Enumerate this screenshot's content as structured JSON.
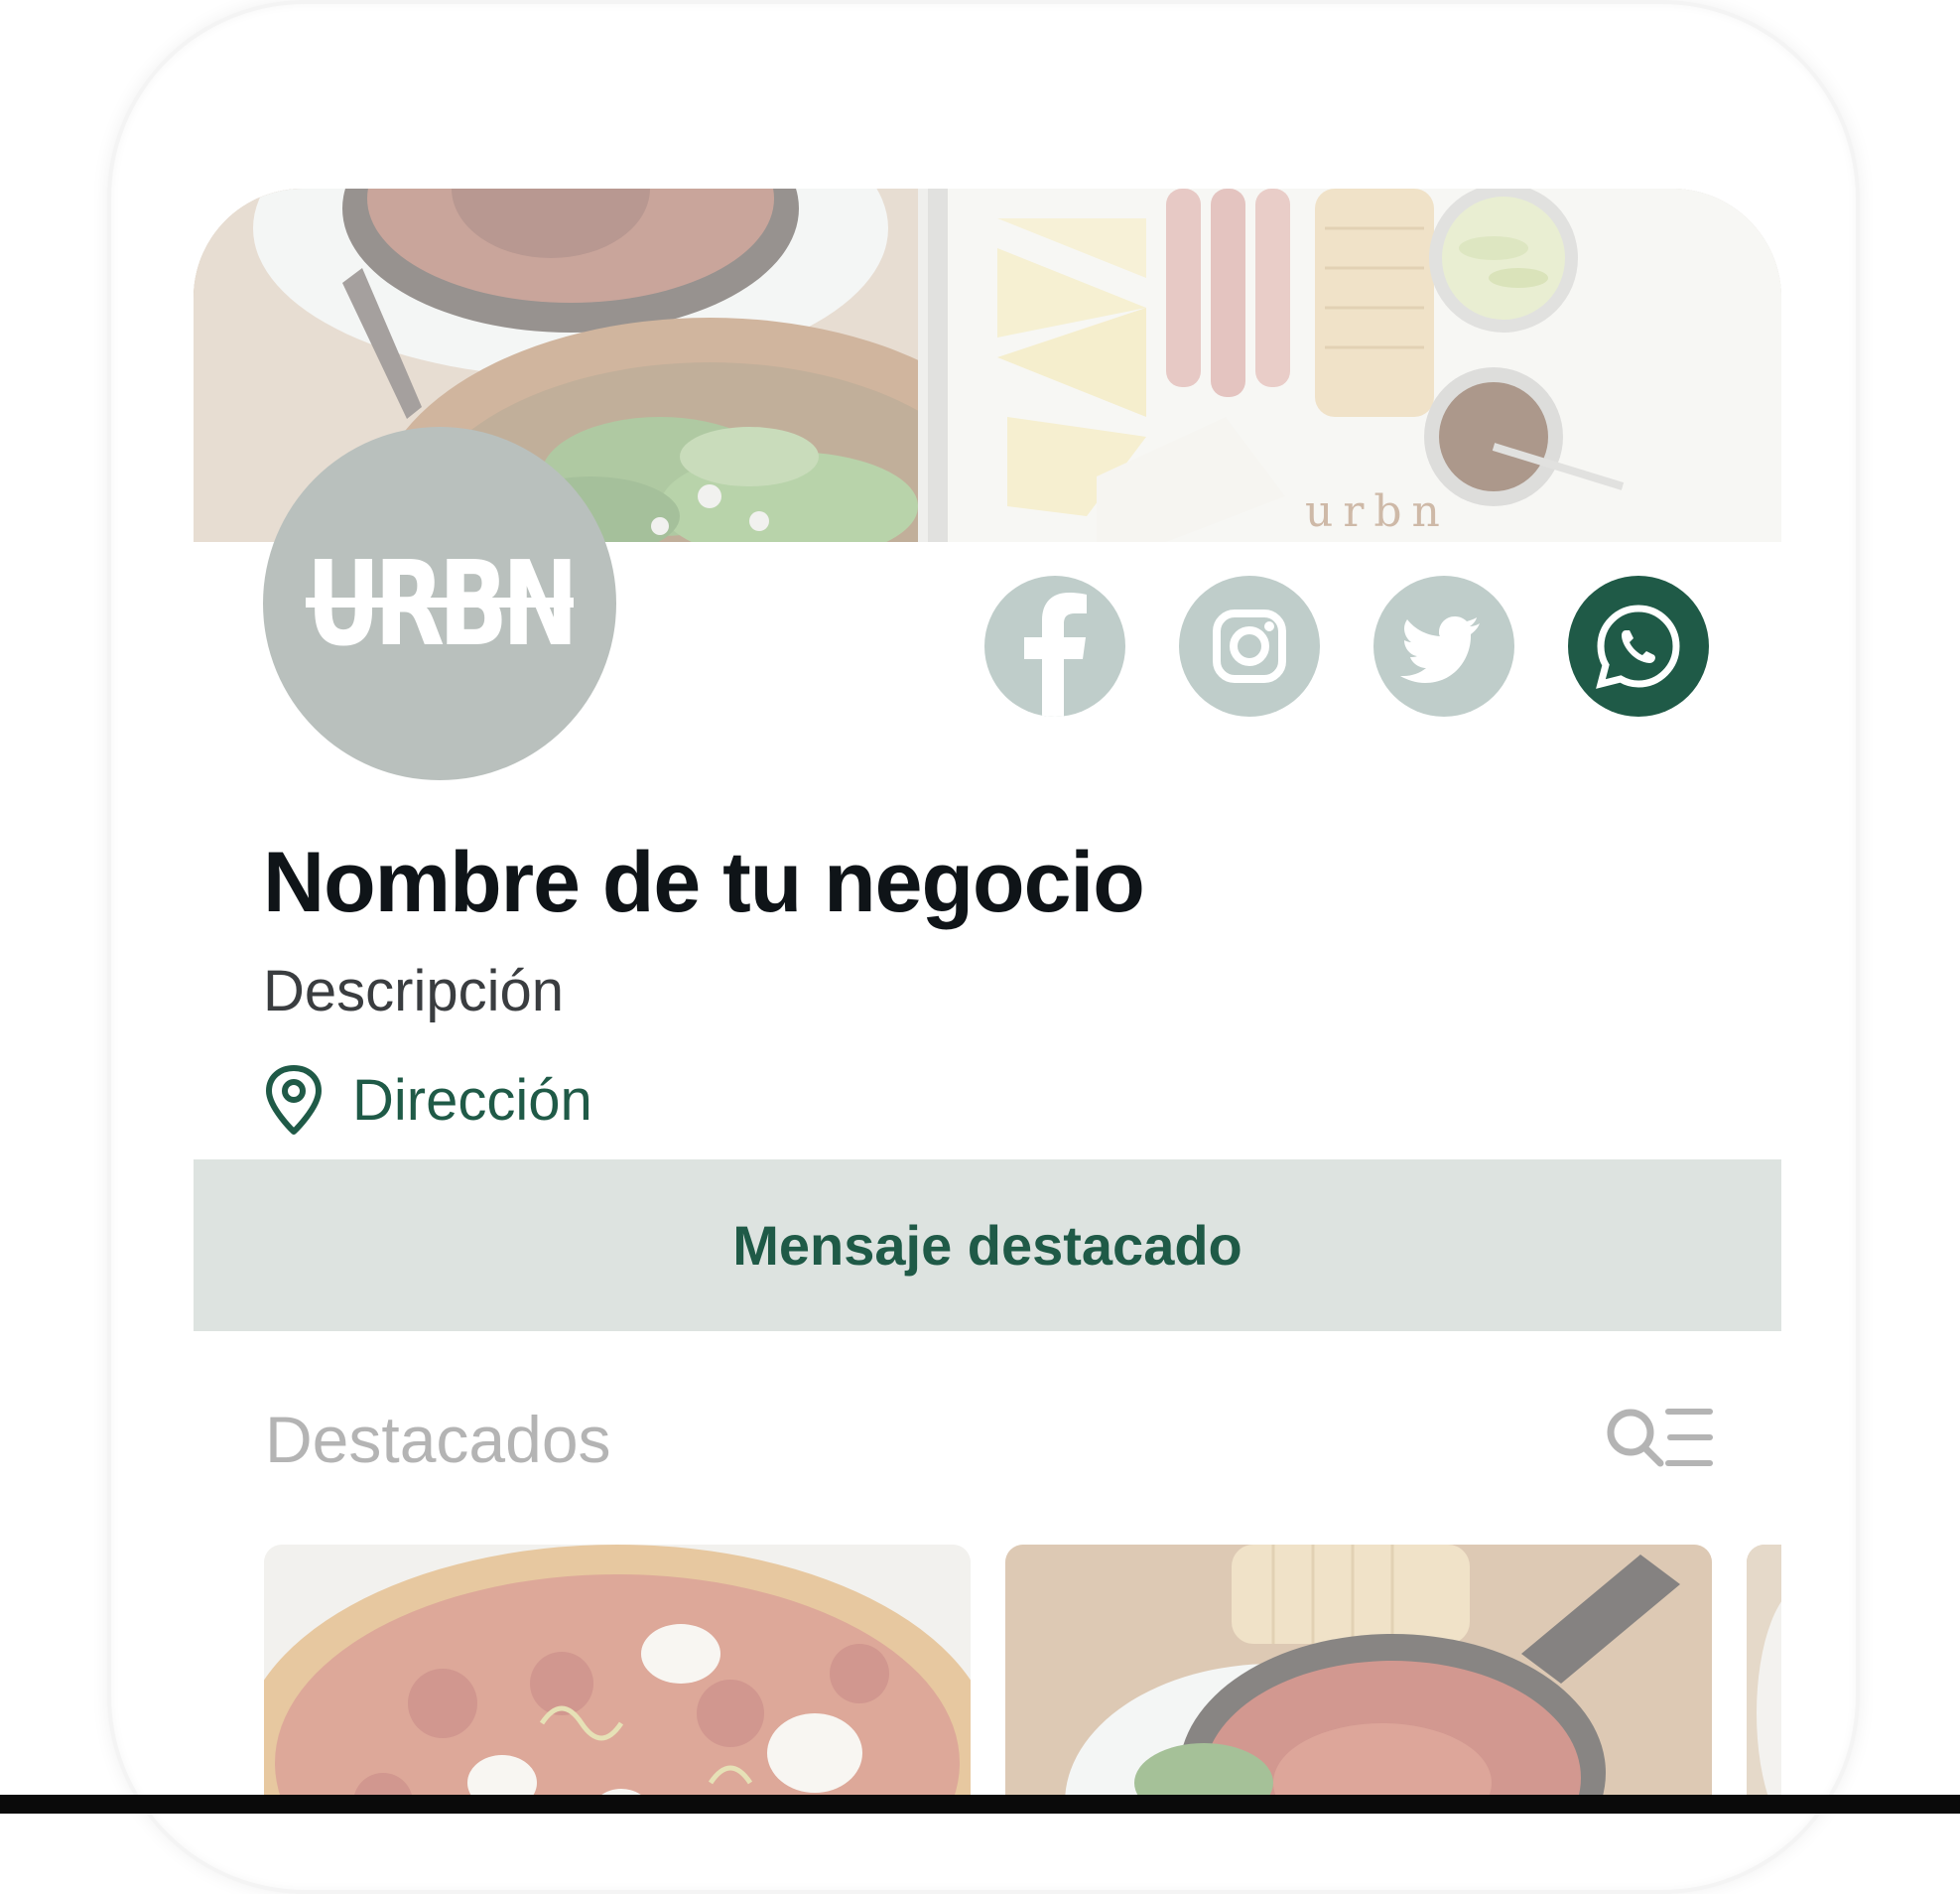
{
  "business": {
    "logo_text": "URBN",
    "name": "Nombre de tu negocio",
    "description": "Descripción",
    "address": "Dirección"
  },
  "social": [
    {
      "icon": "facebook-icon",
      "color": "#bfcdca"
    },
    {
      "icon": "instagram-icon",
      "color": "#bfcdca"
    },
    {
      "icon": "twitter-icon",
      "color": "#bfcdca"
    },
    {
      "icon": "whatsapp-icon",
      "color": "#1f5a47"
    }
  ],
  "banner": {
    "text": "Mensaje destacado"
  },
  "featured": {
    "title": "Destacados",
    "search_icon": "search-list-icon",
    "items": [
      {
        "image": "pizza-photo"
      },
      {
        "image": "skillet-dish-photo"
      },
      {
        "image": "partial-card-photo"
      }
    ]
  },
  "colors": {
    "brand_green": "#1f5a47",
    "avatar_gray": "#b9c0bd",
    "social_light": "#bfcdca",
    "banner_bg": "#dde3e0",
    "muted_text": "#b4b4b4"
  }
}
